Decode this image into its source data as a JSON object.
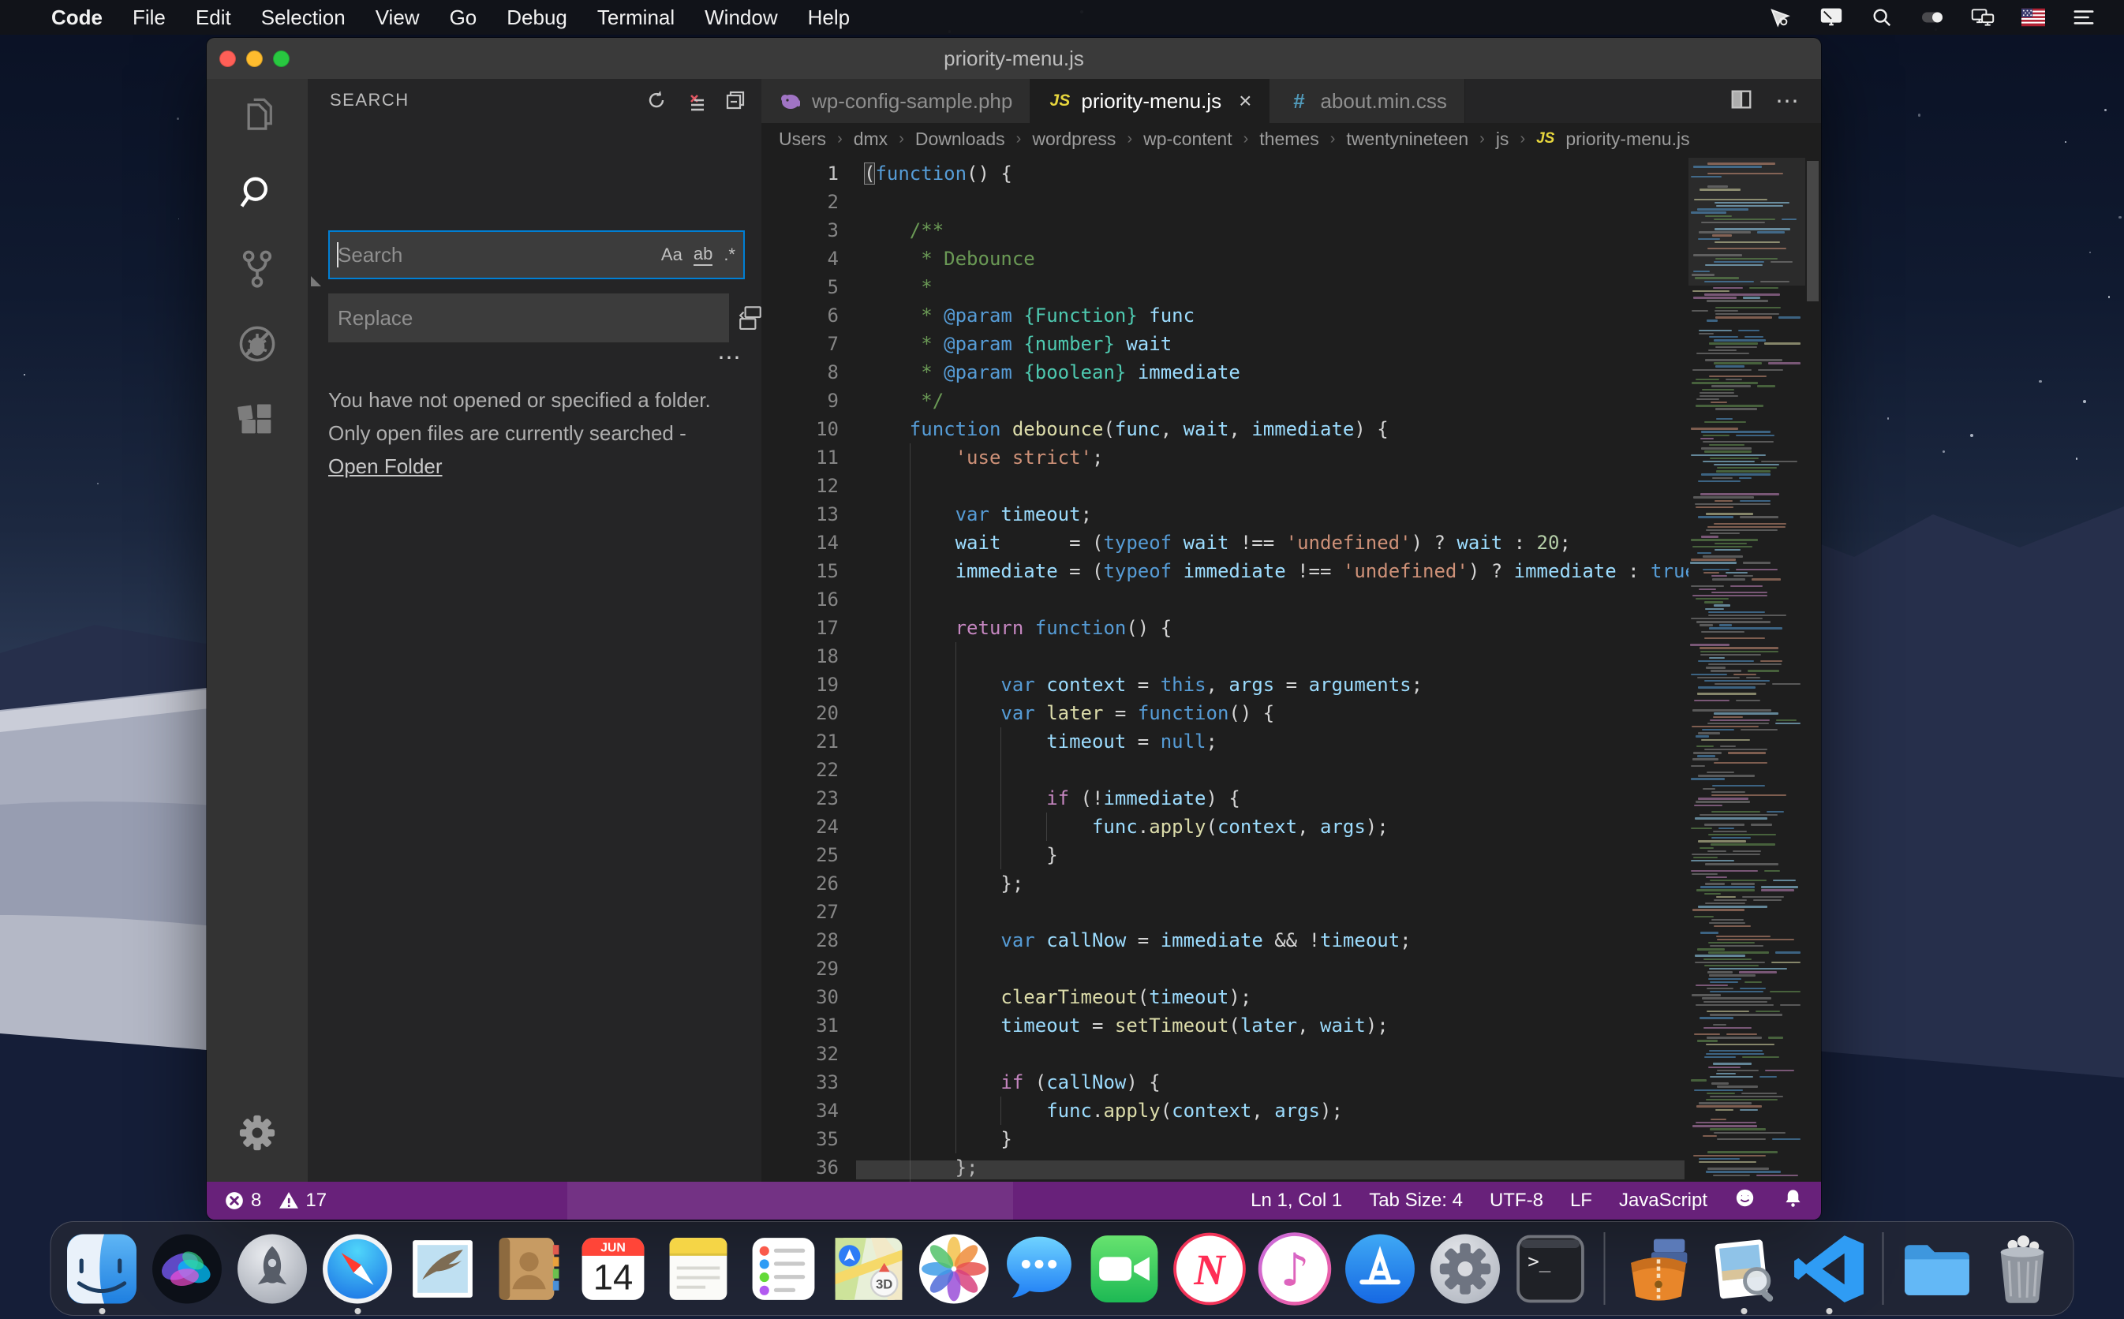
{
  "colors": {
    "status_bar_bg": "#68217a",
    "focus_border": "#007fd4",
    "js_icon": "#e7d63d",
    "css_icon": "#519aba",
    "php_icon": "#a074c4",
    "comment": "#6a9955",
    "keyword": "#569cd6",
    "control": "#c586c0",
    "function": "#dcdcaa",
    "variable": "#9cdcfe",
    "string": "#ce9178",
    "number": "#b5cea8"
  },
  "menu_bar": {
    "apple_logo": "",
    "items": [
      "Code",
      "File",
      "Edit",
      "Selection",
      "View",
      "Go",
      "Debug",
      "Terminal",
      "Window",
      "Help"
    ],
    "status_icons": [
      "remote-cursor",
      "display",
      "spotlight",
      "toggle",
      "displays",
      "input-source-us-flag",
      "notification-list"
    ]
  },
  "window": {
    "title": "priority-menu.js",
    "activity_bar": [
      {
        "id": "explorer",
        "active": false
      },
      {
        "id": "search",
        "active": true
      },
      {
        "id": "source-control",
        "active": false
      },
      {
        "id": "debug-disabled",
        "active": false
      },
      {
        "id": "extensions",
        "active": false
      }
    ],
    "search_panel": {
      "title": "SEARCH",
      "header_icons": [
        "refresh",
        "clear-search-results",
        "collapse-editors"
      ],
      "search_placeholder": "Search",
      "replace_placeholder": "Replace",
      "option_match_case": "Aa",
      "option_whole_word": "ab",
      "option_regex": ".*",
      "more_dots": "⋯",
      "message_line1": "You have not opened or specified a folder.",
      "message_line2": "Only open files are currently searched -",
      "open_folder_link": "Open Folder"
    },
    "tabs": [
      {
        "label": "wp-config-sample.php",
        "icon": "php",
        "active": false
      },
      {
        "label": "priority-menu.js",
        "icon": "js",
        "active": true,
        "close_glyph": "×"
      },
      {
        "label": "about.min.css",
        "icon": "css",
        "active": false
      }
    ],
    "tab_actions_dots": "⋯",
    "icon_glyphs": {
      "js": "JS",
      "css": "#"
    },
    "breadcrumb": [
      "Users",
      "dmx",
      "Downloads",
      "wordpress",
      "wp-content",
      "themes",
      "twentynineteen",
      "js",
      "priority-menu.js"
    ],
    "breadcrumb_sep": "›",
    "editor": {
      "lines": [
        [
          [
            "(",
            "punc bm"
          ],
          [
            "function",
            "kw"
          ],
          [
            "() {",
            "punc"
          ]
        ],
        [],
        [
          [
            "    /**",
            "com"
          ]
        ],
        [
          [
            "     * Debounce",
            "com"
          ]
        ],
        [
          [
            "     *",
            "com"
          ]
        ],
        [
          [
            "     * ",
            "com"
          ],
          [
            "@param",
            "doc"
          ],
          [
            " ",
            "punc"
          ],
          [
            "{Function}",
            "type"
          ],
          [
            " ",
            "punc"
          ],
          [
            "func",
            "var"
          ]
        ],
        [
          [
            "     * ",
            "com"
          ],
          [
            "@param",
            "doc"
          ],
          [
            " ",
            "punc"
          ],
          [
            "{number}",
            "type"
          ],
          [
            " ",
            "punc"
          ],
          [
            "wait",
            "var"
          ]
        ],
        [
          [
            "     * ",
            "com"
          ],
          [
            "@param",
            "doc"
          ],
          [
            " ",
            "punc"
          ],
          [
            "{boolean}",
            "type"
          ],
          [
            " ",
            "punc"
          ],
          [
            "immediate",
            "var"
          ]
        ],
        [
          [
            "     */",
            "com"
          ]
        ],
        [
          [
            "    ",
            "punc"
          ],
          [
            "function",
            "kw"
          ],
          [
            " ",
            "punc"
          ],
          [
            "debounce",
            "fn"
          ],
          [
            "(",
            "punc"
          ],
          [
            "func",
            "var"
          ],
          [
            ", ",
            "punc"
          ],
          [
            "wait",
            "var"
          ],
          [
            ", ",
            "punc"
          ],
          [
            "immediate",
            "var"
          ],
          [
            ") {",
            "punc"
          ]
        ],
        [
          [
            "        ",
            "punc"
          ],
          [
            "'use strict'",
            "str"
          ],
          [
            ";",
            "punc"
          ]
        ],
        [],
        [
          [
            "        ",
            "punc"
          ],
          [
            "var",
            "kw"
          ],
          [
            " ",
            "punc"
          ],
          [
            "timeout",
            "var"
          ],
          [
            ";",
            "punc"
          ]
        ],
        [
          [
            "        ",
            "punc"
          ],
          [
            "wait",
            "var"
          ],
          [
            "      = (",
            "punc"
          ],
          [
            "typeof",
            "kw"
          ],
          [
            " ",
            "punc"
          ],
          [
            "wait",
            "var"
          ],
          [
            " !== ",
            "punc"
          ],
          [
            "'undefined'",
            "str"
          ],
          [
            ") ? ",
            "punc"
          ],
          [
            "wait",
            "var"
          ],
          [
            " : ",
            "punc"
          ],
          [
            "20",
            "num"
          ],
          [
            ";",
            "punc"
          ]
        ],
        [
          [
            "        ",
            "punc"
          ],
          [
            "immediate",
            "var"
          ],
          [
            " = (",
            "punc"
          ],
          [
            "typeof",
            "kw"
          ],
          [
            " ",
            "punc"
          ],
          [
            "immediate",
            "var"
          ],
          [
            " !== ",
            "punc"
          ],
          [
            "'undefined'",
            "str"
          ],
          [
            ") ? ",
            "punc"
          ],
          [
            "immediate",
            "var"
          ],
          [
            " : ",
            "punc"
          ],
          [
            "true",
            "kw"
          ],
          [
            ";",
            "punc"
          ]
        ],
        [],
        [
          [
            "        ",
            "punc"
          ],
          [
            "return",
            "ctrl"
          ],
          [
            " ",
            "punc"
          ],
          [
            "function",
            "kw"
          ],
          [
            "() {",
            "punc"
          ]
        ],
        [],
        [
          [
            "            ",
            "punc"
          ],
          [
            "var",
            "kw"
          ],
          [
            " ",
            "punc"
          ],
          [
            "context",
            "var"
          ],
          [
            " = ",
            "punc"
          ],
          [
            "this",
            "kw"
          ],
          [
            ", ",
            "punc"
          ],
          [
            "args",
            "var"
          ],
          [
            " = ",
            "punc"
          ],
          [
            "arguments",
            "var"
          ],
          [
            ";",
            "punc"
          ]
        ],
        [
          [
            "            ",
            "punc"
          ],
          [
            "var",
            "kw"
          ],
          [
            " ",
            "punc"
          ],
          [
            "later",
            "fn"
          ],
          [
            " = ",
            "punc"
          ],
          [
            "function",
            "kw"
          ],
          [
            "() {",
            "punc"
          ]
        ],
        [
          [
            "                ",
            "punc"
          ],
          [
            "timeout",
            "var"
          ],
          [
            " = ",
            "punc"
          ],
          [
            "null",
            "kw"
          ],
          [
            ";",
            "punc"
          ]
        ],
        [],
        [
          [
            "                ",
            "punc"
          ],
          [
            "if",
            "ctrl"
          ],
          [
            " (!",
            "punc"
          ],
          [
            "immediate",
            "var"
          ],
          [
            ") {",
            "punc"
          ]
        ],
        [
          [
            "                    ",
            "punc"
          ],
          [
            "func",
            "var"
          ],
          [
            ".",
            "punc"
          ],
          [
            "apply",
            "fn"
          ],
          [
            "(",
            "punc"
          ],
          [
            "context",
            "var"
          ],
          [
            ", ",
            "punc"
          ],
          [
            "args",
            "var"
          ],
          [
            ");",
            "punc"
          ]
        ],
        [
          [
            "                }",
            "punc"
          ]
        ],
        [
          [
            "            };",
            "punc"
          ]
        ],
        [],
        [
          [
            "            ",
            "punc"
          ],
          [
            "var",
            "kw"
          ],
          [
            " ",
            "punc"
          ],
          [
            "callNow",
            "var"
          ],
          [
            " = ",
            "punc"
          ],
          [
            "immediate",
            "var"
          ],
          [
            " && !",
            "punc"
          ],
          [
            "timeout",
            "var"
          ],
          [
            ";",
            "punc"
          ]
        ],
        [],
        [
          [
            "            ",
            "punc"
          ],
          [
            "clearTimeout",
            "fn"
          ],
          [
            "(",
            "punc"
          ],
          [
            "timeout",
            "var"
          ],
          [
            ");",
            "punc"
          ]
        ],
        [
          [
            "            ",
            "punc"
          ],
          [
            "timeout",
            "var"
          ],
          [
            " = ",
            "punc"
          ],
          [
            "setTimeout",
            "fn"
          ],
          [
            "(",
            "punc"
          ],
          [
            "later",
            "var"
          ],
          [
            ", ",
            "punc"
          ],
          [
            "wait",
            "var"
          ],
          [
            ");",
            "punc"
          ]
        ],
        [],
        [
          [
            "            ",
            "punc"
          ],
          [
            "if",
            "ctrl"
          ],
          [
            " (",
            "punc"
          ],
          [
            "callNow",
            "var"
          ],
          [
            ") {",
            "punc"
          ]
        ],
        [
          [
            "                ",
            "punc"
          ],
          [
            "func",
            "var"
          ],
          [
            ".",
            "punc"
          ],
          [
            "apply",
            "fn"
          ],
          [
            "(",
            "punc"
          ],
          [
            "context",
            "var"
          ],
          [
            ", ",
            "punc"
          ],
          [
            "args",
            "var"
          ],
          [
            ");",
            "punc"
          ]
        ],
        [
          [
            "            }",
            "punc"
          ]
        ],
        [
          [
            "        };",
            "punc"
          ]
        ]
      ]
    },
    "status_bar": {
      "errors": "8",
      "warnings": "17",
      "items": [
        "Ln 1, Col 1",
        "Tab Size: 4",
        "UTF-8",
        "LF",
        "JavaScript"
      ]
    }
  },
  "dock": {
    "calendar": {
      "month": "JUN",
      "day": "14"
    },
    "maps_badge": "3D",
    "terminal_glyph": ">_",
    "news_glyph": "N",
    "items": [
      {
        "id": "finder",
        "running": true
      },
      {
        "id": "siri",
        "running": false
      },
      {
        "id": "launchpad",
        "running": false
      },
      {
        "id": "safari",
        "running": true
      },
      {
        "id": "mail",
        "running": false
      },
      {
        "id": "contacts",
        "running": false
      },
      {
        "id": "calendar",
        "running": false
      },
      {
        "id": "notes",
        "running": false
      },
      {
        "id": "reminders",
        "running": false
      },
      {
        "id": "maps",
        "running": false
      },
      {
        "id": "photos",
        "running": false
      },
      {
        "id": "messages",
        "running": false
      },
      {
        "id": "facetime",
        "running": false
      },
      {
        "id": "news",
        "running": false
      },
      {
        "id": "itunes",
        "running": false
      },
      {
        "id": "appstore",
        "running": false
      },
      {
        "id": "system-preferences",
        "running": false
      },
      {
        "id": "terminal",
        "running": false
      },
      {
        "id": "separator"
      },
      {
        "id": "unarchiver",
        "running": false
      },
      {
        "id": "preview",
        "running": true
      },
      {
        "id": "vscode",
        "running": true
      },
      {
        "id": "separator"
      },
      {
        "id": "downloads-folder",
        "running": false
      },
      {
        "id": "trash",
        "running": false
      }
    ]
  }
}
